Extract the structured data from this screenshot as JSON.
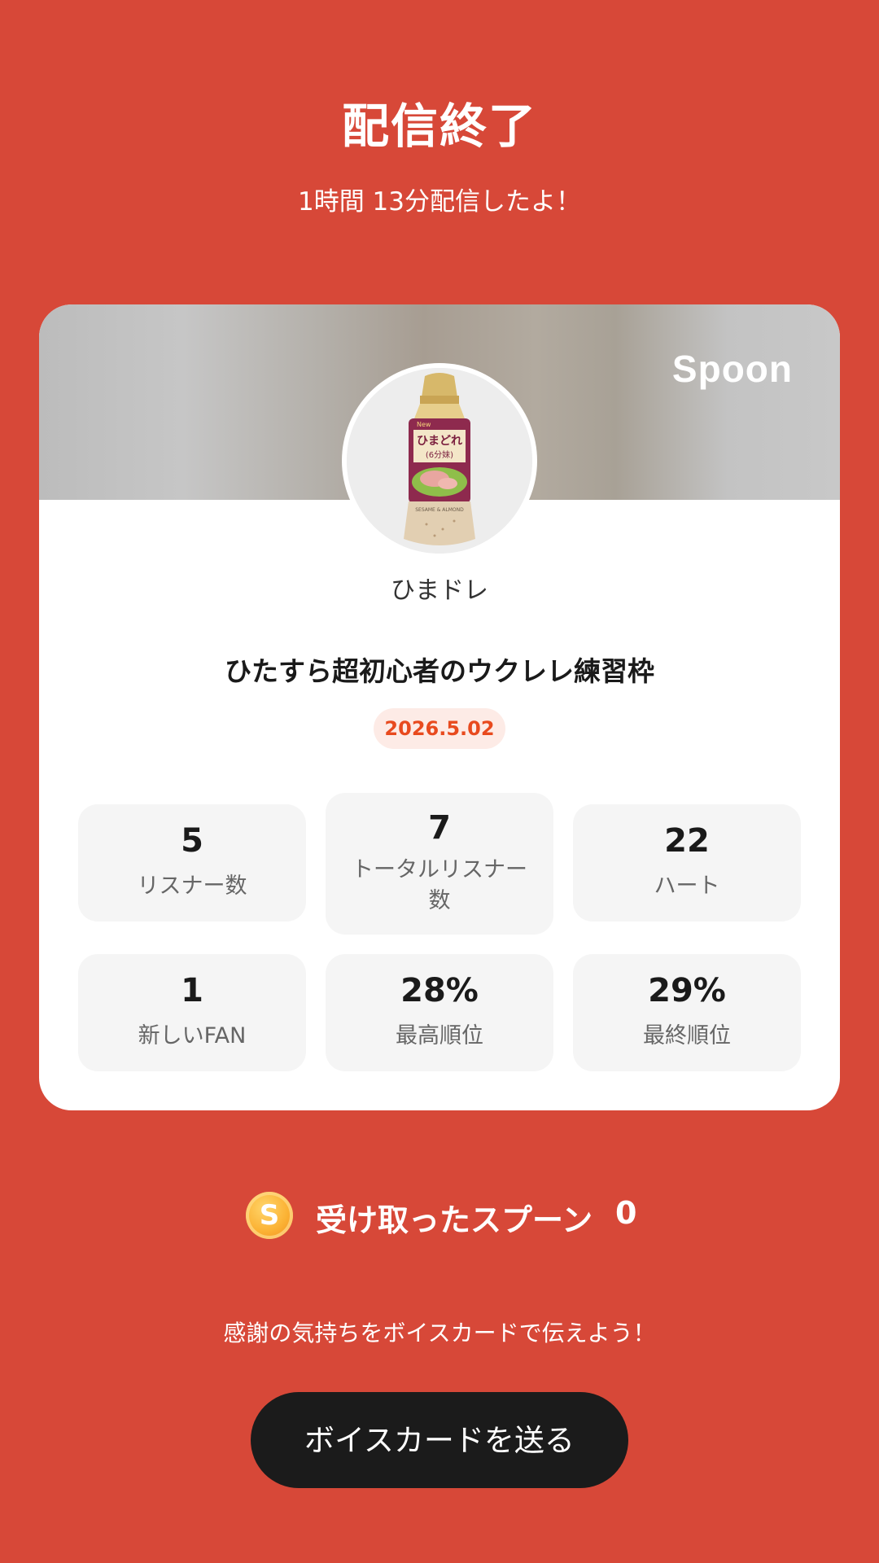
{
  "header": {
    "title": "配信終了",
    "duration_text": "1時間 13分配信したよ！"
  },
  "card": {
    "brand": "Spoon",
    "host_name": "ひまドレ",
    "live_title": "ひたすら超初心者のウクレレ練習枠",
    "date": "2026.5.02",
    "avatar_bottle_label_line1": "ひまどれ",
    "avatar_bottle_label_line2": "(6分妹)",
    "avatar_bottle_bottom_text": "SESAME & ALMOND",
    "avatar_bottle_new": "New",
    "stats": [
      {
        "value": "5",
        "label": "リスナー数"
      },
      {
        "value": "7",
        "label_line1": "トータルリスナー",
        "label_line2": "数"
      },
      {
        "value": "22",
        "label": "ハート"
      },
      {
        "value": "1",
        "label": "新しいFAN"
      },
      {
        "value": "28%",
        "label": "最高順位"
      },
      {
        "value": "29%",
        "label": "最終順位"
      }
    ]
  },
  "spoons": {
    "coin_letter": "S",
    "label": "受け取ったスプーン",
    "count": "0"
  },
  "footer": {
    "message": "感謝の気持ちをボイスカードで伝えよう！",
    "button_label": "ボイスカードを送る"
  },
  "colors": {
    "background": "#D74838",
    "date_badge_text": "#E84A1E",
    "button": "#1B1B1B"
  }
}
